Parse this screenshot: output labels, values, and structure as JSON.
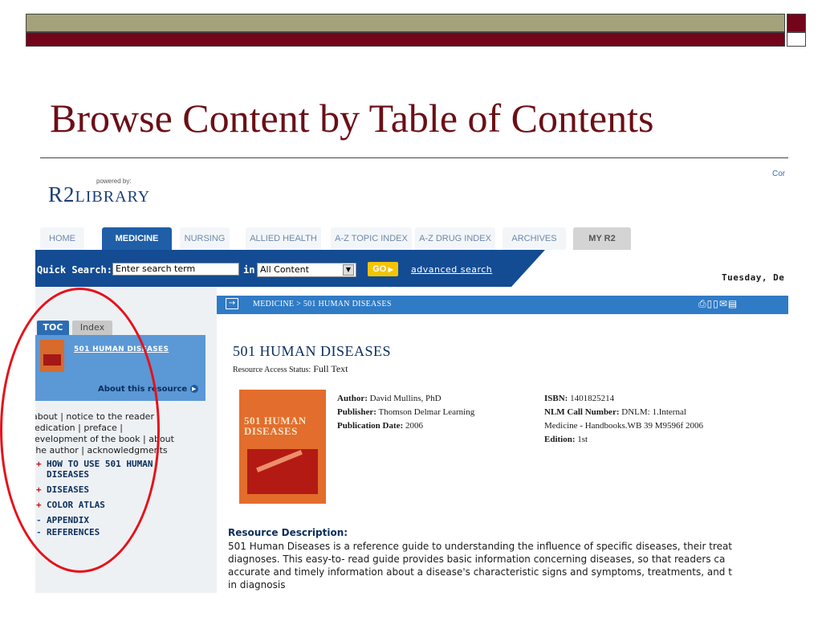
{
  "slide": {
    "title": "Browse Content by Table of Contents",
    "colors": {
      "olive": "#a3a27a",
      "maroon": "#73051a",
      "annotation_circle": "#e5121a"
    }
  },
  "site": {
    "powered_by": "powered by:",
    "logo": "R2LIBRARY",
    "corner_link": "Cor"
  },
  "nav": {
    "tabs": [
      "HOME",
      "MEDICINE",
      "NURSING",
      "ALLIED HEALTH",
      "A-Z TOPIC INDEX",
      "A-Z DRUG INDEX",
      "ARCHIVES",
      "MY R2"
    ],
    "active": "MEDICINE"
  },
  "quick_search": {
    "label": "Quick Search:",
    "value": "Enter search term",
    "in_label": "in",
    "scope_selected": "All Content",
    "go_label": "GO",
    "advanced_link": "advanced search",
    "date_text": "Tuesday, De"
  },
  "breadcrumb": {
    "text": "MEDICINE  >  501 HUMAN DISEASES",
    "icons": [
      "print-icon",
      "book-icon",
      "email-icon",
      "save-icon"
    ]
  },
  "sidebar": {
    "tabs": [
      "TOC",
      "Index"
    ],
    "resource_title": "501 HUMAN DISEASES",
    "about_link": "About this resource",
    "front_matter_lines": [
      "about  |  notice to the reader  |",
      "dedication  |  preface  |",
      "development of the book  |  about",
      "the author  |  acknowledgments"
    ],
    "toc": [
      {
        "marker": "+",
        "label_lines": [
          "HOW TO USE 501 HUMAN",
          "DISEASES"
        ]
      },
      {
        "marker": "+",
        "label_lines": [
          "DISEASES"
        ]
      },
      {
        "marker": "+",
        "label_lines": [
          "COLOR ATLAS"
        ]
      },
      {
        "marker": "-",
        "label_lines": [
          "APPENDIX"
        ]
      },
      {
        "marker": "-",
        "label_lines": [
          "REFERENCES"
        ]
      }
    ]
  },
  "book": {
    "title": "501 HUMAN DISEASES",
    "access_label": "Resource Access Status:",
    "access_value": "Full Text",
    "cover_text": "501 HUMAN DISEASES",
    "author_label": "Author:",
    "author": "David Mullins, PhD",
    "publisher_label": "Publisher:",
    "publisher": "Thomson Delmar Learning",
    "pubdate_label": "Publication Date:",
    "pubdate": "2006",
    "isbn_label": "ISBN:",
    "isbn": "1401825214",
    "nlm_label": "NLM Call Number:",
    "nlm_line1": "DNLM: 1.Internal",
    "nlm_line2": "Medicine - Handbooks.WB 39 M9596f 2006",
    "edition_label": "Edition:",
    "edition": "1st",
    "description_heading": "Resource Description:",
    "description_lines": [
      "501 Human Diseases is a reference guide to understanding the influence of specific diseases, their treat",
      "diagnoses. This easy-to- read guide provides basic information concerning diseases, so that readers ca",
      "accurate and timely information about a disease's characteristic signs and symptoms, treatments, and t",
      "in diagnosis"
    ]
  }
}
